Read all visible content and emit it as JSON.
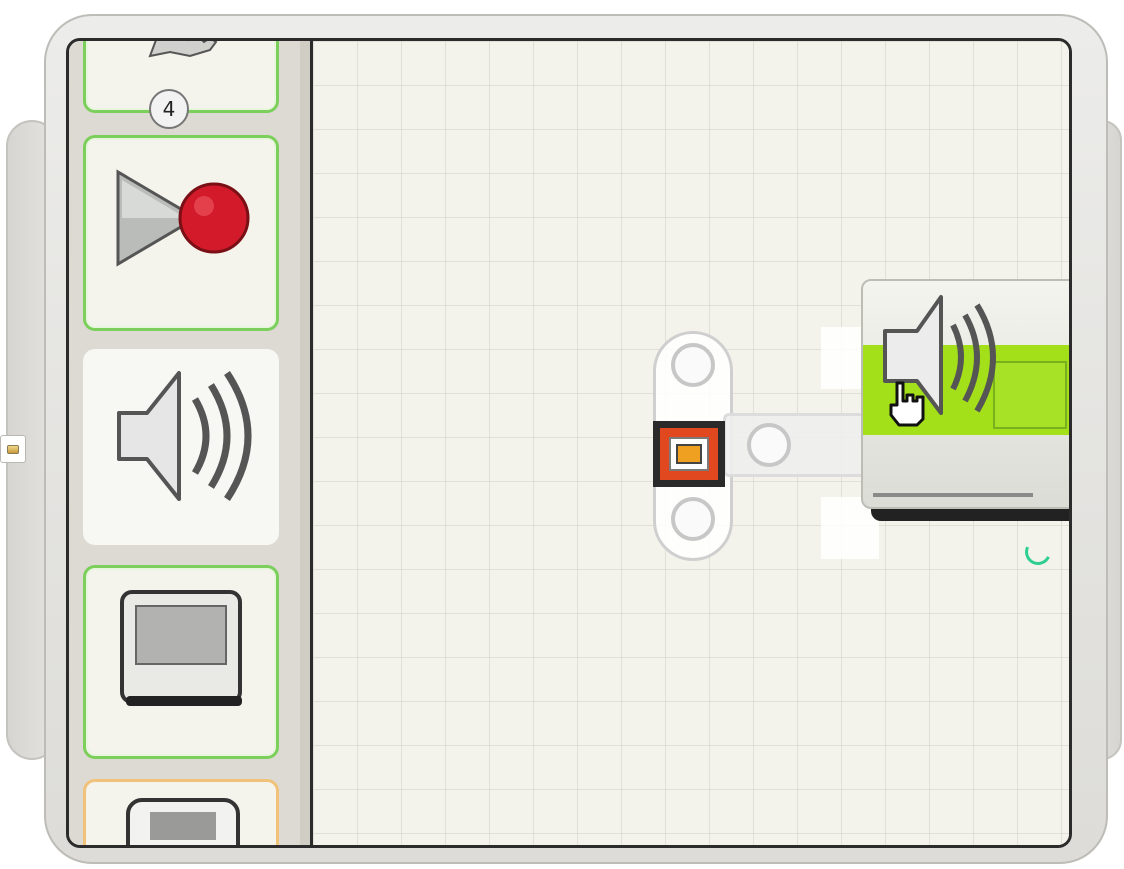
{
  "palette": {
    "badge": "4",
    "items": [
      {
        "name": "gear-icon",
        "state": "partially-visible"
      },
      {
        "name": "record-play-icon",
        "state": "default"
      },
      {
        "name": "sound-icon",
        "state": "selected"
      },
      {
        "name": "display-icon",
        "state": "default"
      },
      {
        "name": "display-2-icon",
        "state": "partially-visible"
      }
    ]
  },
  "canvas": {
    "blocks": [
      {
        "name": "sequence-start-beam"
      },
      {
        "name": "sound-block",
        "state": "being-dragged",
        "accent": "#a3e01a"
      }
    ]
  },
  "colors": {
    "green_tile_border": "#7ccf5a",
    "orange_tile_border": "#f0c27a",
    "start_point_red": "#e2481f",
    "record_red": "#d21a2a",
    "sound_green": "#a3e01a",
    "spinner_teal": "#2fcf8f"
  }
}
